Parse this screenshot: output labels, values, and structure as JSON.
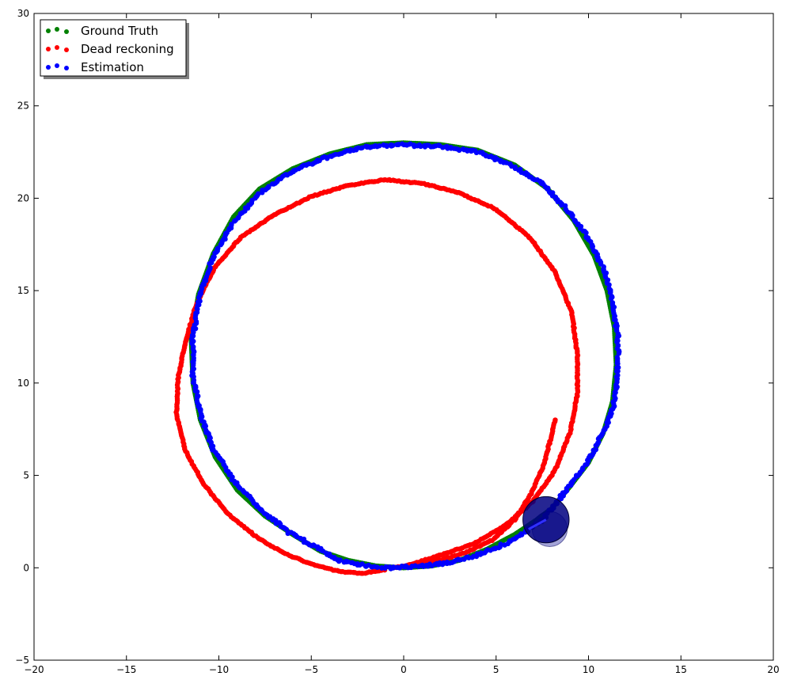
{
  "chart_data": {
    "type": "scatter",
    "title": "",
    "xlabel": "",
    "ylabel": "",
    "xlim": [
      -20,
      20
    ],
    "ylim": [
      -5,
      30
    ],
    "xticks": [
      -20,
      -15,
      -10,
      -5,
      0,
      5,
      10,
      15,
      20
    ],
    "yticks": [
      -5,
      0,
      5,
      10,
      15,
      20,
      25,
      30
    ],
    "xtick_labels": [
      "−20",
      "−15",
      "−10",
      "−5",
      "0",
      "5",
      "10",
      "15",
      "20"
    ],
    "ytick_labels": [
      "−5",
      "0",
      "5",
      "10",
      "15",
      "20",
      "25",
      "30"
    ],
    "grid": false,
    "legend": {
      "position": "top-left",
      "entries": [
        "Ground Truth",
        "Dead reckoning",
        "Estimation"
      ]
    },
    "series": [
      {
        "name": "Ground Truth",
        "color": "#008000",
        "shape": "circle",
        "center": [
          0.0,
          11.5
        ],
        "radius": 11.5,
        "points": [
          [
            0.0,
            0.0
          ],
          [
            1.5,
            0.1
          ],
          [
            3.0,
            0.4
          ],
          [
            4.5,
            1.0
          ],
          [
            6.0,
            1.8
          ],
          [
            7.2,
            2.6
          ],
          [
            8.0,
            3.2
          ],
          [
            9.0,
            4.4
          ],
          [
            10.0,
            5.7
          ],
          [
            10.8,
            7.3
          ],
          [
            11.3,
            9.0
          ],
          [
            11.5,
            11.0
          ],
          [
            11.4,
            13.0
          ],
          [
            11.0,
            15.0
          ],
          [
            10.3,
            16.9
          ],
          [
            9.2,
            18.8
          ],
          [
            7.8,
            20.5
          ],
          [
            6.0,
            21.8
          ],
          [
            4.0,
            22.6
          ],
          [
            2.0,
            22.9
          ],
          [
            0.0,
            23.0
          ],
          [
            -2.0,
            22.9
          ],
          [
            -4.0,
            22.4
          ],
          [
            -6.0,
            21.6
          ],
          [
            -7.8,
            20.5
          ],
          [
            -9.2,
            19.0
          ],
          [
            -10.3,
            17.0
          ],
          [
            -11.1,
            14.8
          ],
          [
            -11.5,
            12.5
          ],
          [
            -11.4,
            10.0
          ],
          [
            -11.0,
            8.0
          ],
          [
            -10.2,
            6.0
          ],
          [
            -9.0,
            4.2
          ],
          [
            -7.5,
            2.8
          ],
          [
            -6.0,
            1.8
          ],
          [
            -4.5,
            0.9
          ],
          [
            -3.0,
            0.4
          ],
          [
            -1.5,
            0.1
          ],
          [
            0.0,
            0.0
          ]
        ]
      },
      {
        "name": "Dead reckoning",
        "color": "#ff0000",
        "shape": "path",
        "points": [
          [
            -1.0,
            -0.1
          ],
          [
            -2.2,
            -0.3
          ],
          [
            -3.5,
            -0.2
          ],
          [
            -5.0,
            0.2
          ],
          [
            -6.5,
            0.8
          ],
          [
            -8.0,
            1.7
          ],
          [
            -9.5,
            2.9
          ],
          [
            -10.8,
            4.5
          ],
          [
            -11.8,
            6.3
          ],
          [
            -12.3,
            8.3
          ],
          [
            -12.2,
            10.3
          ],
          [
            -11.8,
            12.3
          ],
          [
            -11.2,
            14.3
          ],
          [
            -10.2,
            16.3
          ],
          [
            -8.8,
            17.9
          ],
          [
            -7.0,
            19.1
          ],
          [
            -5.0,
            20.1
          ],
          [
            -3.0,
            20.7
          ],
          [
            -1.0,
            21.0
          ],
          [
            1.0,
            20.8
          ],
          [
            3.0,
            20.3
          ],
          [
            5.0,
            19.4
          ],
          [
            6.8,
            17.9
          ],
          [
            8.2,
            16.0
          ],
          [
            9.1,
            13.8
          ],
          [
            9.4,
            11.5
          ],
          [
            9.4,
            9.4
          ],
          [
            9.0,
            7.3
          ],
          [
            8.2,
            5.3
          ],
          [
            7.0,
            3.6
          ],
          [
            5.5,
            2.3
          ],
          [
            3.8,
            1.3
          ],
          [
            2.0,
            0.7
          ],
          [
            0.5,
            0.2
          ],
          [
            -0.5,
            0.0
          ],
          [
            1.5,
            0.3
          ],
          [
            3.3,
            0.8
          ],
          [
            4.8,
            1.5
          ],
          [
            6.0,
            2.6
          ],
          [
            6.9,
            4.0
          ],
          [
            7.6,
            5.6
          ],
          [
            8.2,
            8.0
          ]
        ]
      },
      {
        "name": "Estimation",
        "color": "#0000ff",
        "shape": "noisy-circle",
        "center": [
          0.0,
          11.5
        ],
        "radius": 11.5,
        "points": [
          [
            -3.5,
            0.4
          ],
          [
            -2.0,
            0.1
          ],
          [
            -0.5,
            0.0
          ],
          [
            1.0,
            0.1
          ],
          [
            2.5,
            0.3
          ],
          [
            4.0,
            0.7
          ],
          [
            5.5,
            1.3
          ],
          [
            6.7,
            2.0
          ],
          [
            7.5,
            2.6
          ],
          [
            8.8,
            4.2
          ],
          [
            10.0,
            5.8
          ],
          [
            10.9,
            7.5
          ],
          [
            11.4,
            9.0
          ],
          [
            11.6,
            11.0
          ],
          [
            11.6,
            12.5
          ],
          [
            11.3,
            14.3
          ],
          [
            10.9,
            16.0
          ],
          [
            10.0,
            17.8
          ],
          [
            8.9,
            19.3
          ],
          [
            7.5,
            20.8
          ],
          [
            5.8,
            21.8
          ],
          [
            4.0,
            22.5
          ],
          [
            2.0,
            22.8
          ],
          [
            0.0,
            22.9
          ],
          [
            -2.0,
            22.8
          ],
          [
            -4.0,
            22.3
          ],
          [
            -6.0,
            21.5
          ],
          [
            -7.8,
            20.3
          ],
          [
            -9.2,
            18.7
          ],
          [
            -10.3,
            16.8
          ],
          [
            -11.0,
            14.8
          ],
          [
            -11.4,
            12.5
          ],
          [
            -11.4,
            10.3
          ],
          [
            -11.0,
            8.3
          ],
          [
            -10.3,
            6.4
          ],
          [
            -9.2,
            4.7
          ],
          [
            -7.8,
            3.2
          ],
          [
            -6.2,
            1.9
          ],
          [
            -4.5,
            1.0
          ],
          [
            -3.5,
            0.4
          ]
        ]
      }
    ],
    "robot_marker": {
      "center": [
        7.7,
        2.6
      ],
      "radius": 1.25,
      "color": "#000080",
      "uncertainty_center": [
        7.9,
        2.1
      ],
      "uncertainty_radius": 0.95,
      "uncertainty_color": "#1a1a9a"
    }
  }
}
